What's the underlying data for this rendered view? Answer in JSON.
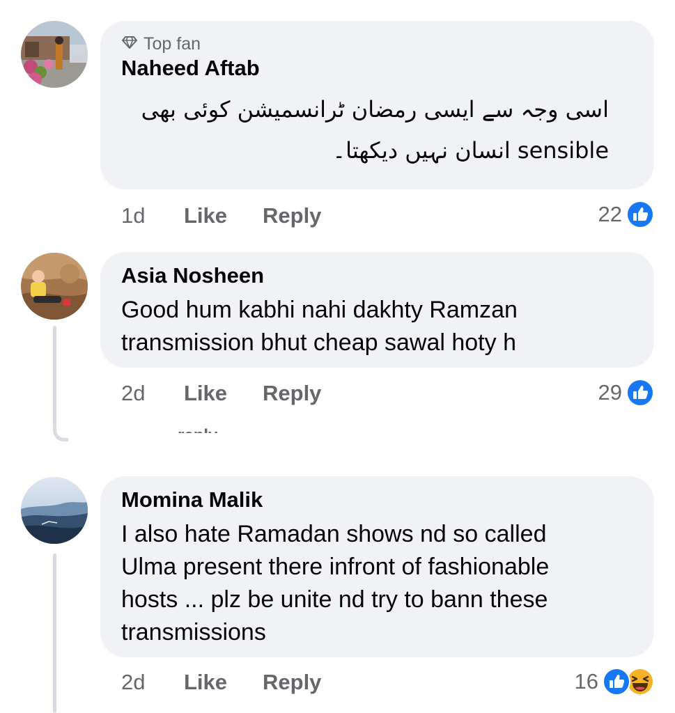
{
  "comments": [
    {
      "badge": "Top fan",
      "author": "Naheed Aftab",
      "lines": [
        "اسی وجہ سے ایسی رمضان ٹرانسمیشن کوئی بھی",
        "sensible انسان نہیں دیکھتا۔"
      ],
      "time": "1d",
      "like_label": "Like",
      "reply_label": "Reply",
      "reaction_count": "22"
    },
    {
      "author": "Asia Nosheen",
      "lines": [
        "Good hum kabhi nahi dakhty Ramzan",
        "transmission bhut cheap sawal hoty h"
      ],
      "time": "2d",
      "like_label": "Like",
      "reply_label": "Reply",
      "reaction_count": "29"
    },
    {
      "author": "Momina Malik",
      "lines": [
        "I also hate Ramadan shows nd so called",
        "Ulma  present there infront of fashionable",
        "hosts ... plz be unite nd try to bann these",
        "transmissions"
      ],
      "time": "2d",
      "like_label": "Like",
      "reply_label": "Reply",
      "reaction_count": "16"
    }
  ],
  "partial_reply_text": "reply",
  "icons": {
    "badge": "diamond-icon",
    "like": "like-reaction-icon",
    "haha": "haha-reaction-icon"
  },
  "colors": {
    "like_blue": "#1877f2",
    "bubble_bg": "#f0f2f5",
    "meta_text": "#65676b",
    "haha_yellow": "#f7b125"
  }
}
